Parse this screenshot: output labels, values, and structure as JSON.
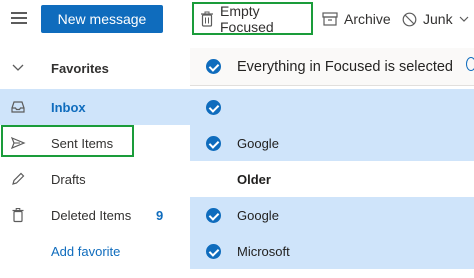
{
  "toolbar": {
    "new_message_label": "New message",
    "empty_focused_label": "Empty Focused",
    "archive_label": "Archive",
    "junk_label": "Junk"
  },
  "sidebar": {
    "favorites_label": "Favorites",
    "items": [
      {
        "label": "Inbox",
        "icon": "inbox-icon"
      },
      {
        "label": "Sent Items",
        "icon": "send-icon"
      },
      {
        "label": "Drafts",
        "icon": "pencil-icon"
      },
      {
        "label": "Deleted Items",
        "icon": "trash-icon",
        "count": "9"
      },
      {
        "label": "Add favorite"
      }
    ]
  },
  "message_list": {
    "selection_banner": "Everything in Focused is selected",
    "rows": [
      {
        "sender": ""
      },
      {
        "sender": "Google"
      },
      {
        "sender": "Google"
      },
      {
        "sender": "Microsoft"
      }
    ],
    "group_header": "Older"
  },
  "colors": {
    "accent": "#0f6cbd",
    "selected_bg": "#cfe4fa",
    "highlight_outline": "#1a9c3a"
  }
}
